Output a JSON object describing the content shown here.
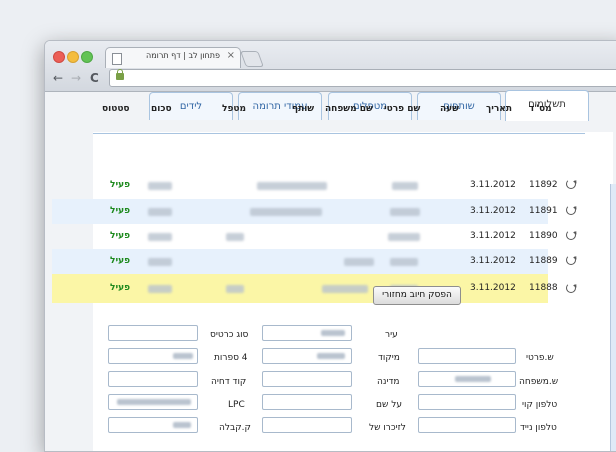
{
  "browser": {
    "tab_title": "פתחון לב | דף תרומה",
    "tab_close": "×",
    "back": "←",
    "forward": "→",
    "reload": "C"
  },
  "tabs": [
    {
      "label": "תשלומים",
      "active": true
    },
    {
      "label": "שותפים",
      "active": false
    },
    {
      "label": "מטפלים",
      "active": false
    },
    {
      "label": "עמודי תרומה",
      "active": false
    },
    {
      "label": "לידים",
      "active": false
    }
  ],
  "table": {
    "headers": {
      "id": "מס\"ד",
      "date": "תאריך",
      "time": "שעה",
      "first_name": "שם פרטי",
      "last_name": "שם משפחה",
      "partner": "שותף",
      "handler": "מטפל",
      "amount": "סכום",
      "status": "סטטוס"
    },
    "rows": [
      {
        "id": "11892",
        "date": "3.11.2012",
        "status": "פעיל"
      },
      {
        "id": "11891",
        "date": "3.11.2012",
        "status": "פעיל"
      },
      {
        "id": "11890",
        "date": "3.11.2012",
        "status": "פעיל"
      },
      {
        "id": "11889",
        "date": "3.11.2012",
        "status": "פעיל"
      },
      {
        "id": "11888",
        "date": "3.11.2012",
        "status": "פעיל"
      }
    ]
  },
  "form": {
    "stop_button": "הפסק חיוב מחזורי",
    "col1": [
      "ש.פרטי",
      "ש.משפחה",
      "טלפון קוי",
      "טלפון נייד"
    ],
    "col2": [
      "עיר",
      "מיקוד",
      "מדינה",
      "על שם",
      "לזיכרו של"
    ],
    "col3": [
      "סוג כרטיס",
      "4 ספרות",
      "קוד דחיה",
      "LPC",
      "ק.קבלה"
    ]
  },
  "colors": {
    "accent": "#2f64a3",
    "status_active": "#1d8a1d",
    "highlight_row": "#fbf6a6",
    "alt_row": "#e7f1fc"
  }
}
